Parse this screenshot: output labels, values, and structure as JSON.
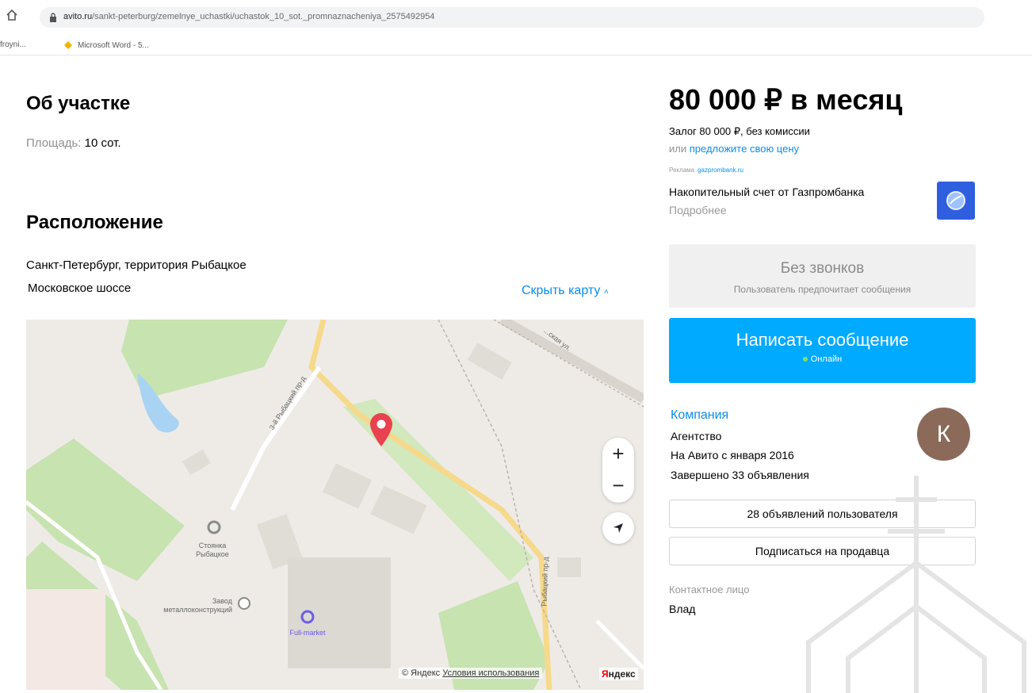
{
  "browser": {
    "url_host": "avito.ru",
    "url_path": "/sankt-peterburg/zemelnye_uchastki/uchastok_10_sot._promnaznacheniya_2575492954",
    "bookmarks": [
      "froyni...",
      "Microsoft Word - 5..."
    ]
  },
  "about": {
    "title": "Об участке",
    "area_label": "Площадь:",
    "area_value": "10 сот."
  },
  "location": {
    "title": "Расположение",
    "address_line1": "Санкт-Петербург, территория Рыбацкое",
    "address_line2": "Московское шоссе",
    "hide_map": "Скрыть карту"
  },
  "map": {
    "labels": {
      "parking": "Стоянка\nРыбацкое",
      "factory": "Завод\nметаллоконструкций",
      "market": "Full-market",
      "street_3": "3-й Рыбацкий пр-д",
      "street_ryb": "Рыбацкий пр-д",
      "street_top": "...ская ул."
    },
    "zoom_in": "+",
    "zoom_out": "−",
    "copyright_prefix": "© Яндекс",
    "terms": "Условия использования",
    "brand_first": "Я",
    "brand_rest": "ндекс"
  },
  "pricing": {
    "price": "80 000 ₽ в месяц",
    "deposit": "Залог 80 000 ₽, без комиссии",
    "offer_prefix": "или",
    "offer_link": "предложите свою цену"
  },
  "ad": {
    "label": "Реклама",
    "domain": "gazprombank.ru",
    "title": "Накопительный счет от Газпромбанка",
    "more": "Подробнее"
  },
  "contact": {
    "no_calls_title": "Без звонков",
    "no_calls_sub": "Пользователь предпочитает сообщения",
    "write_button": "Написать сообщение",
    "online": "Онлайн"
  },
  "seller": {
    "name": "Компания",
    "type": "Агентство",
    "since": "На Авито с января 2016",
    "completed": "Завершено 33 объявления",
    "avatar_letter": "К",
    "listings_button": "28 объявлений пользователя",
    "subscribe_button": "Подписаться на продавца",
    "contact_label": "Контактное лицо",
    "contact_name": "Влад"
  },
  "colors": {
    "accent": "#0a8ee8",
    "button": "#00aaff",
    "pin": "#e8414f",
    "avatar": "#8b6a5a"
  }
}
